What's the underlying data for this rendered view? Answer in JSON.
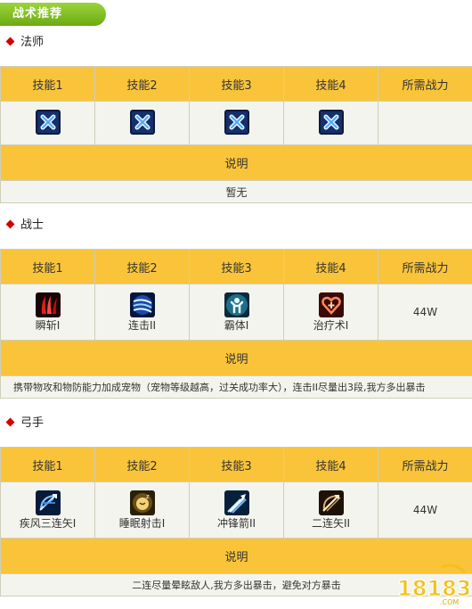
{
  "page": {
    "tab_title": "战术推荐"
  },
  "table_headers": {
    "skill1": "技能1",
    "skill2": "技能2",
    "skill3": "技能3",
    "skill4": "技能4",
    "power": "所需战力",
    "explain": "说明"
  },
  "sections": [
    {
      "title": "法师",
      "skills": [
        {
          "icon": "blank-x-icon",
          "name": ""
        },
        {
          "icon": "blank-x-icon",
          "name": ""
        },
        {
          "icon": "blank-x-icon",
          "name": ""
        },
        {
          "icon": "blank-x-icon",
          "name": ""
        }
      ],
      "power": "",
      "note": "暂无"
    },
    {
      "title": "战士",
      "skills": [
        {
          "icon": "slash-icon",
          "name": "瞬斩I"
        },
        {
          "icon": "combo-strike-icon",
          "name": "连击II"
        },
        {
          "icon": "tyrant-body-icon",
          "name": "霸体I"
        },
        {
          "icon": "heal-heart-icon",
          "name": "治疗术I"
        }
      ],
      "power": "44W",
      "note": "携带物攻和物防能力加成宠物（宠物等级越高，过关成功率大），连击II尽量出3段,我方多出暴击"
    },
    {
      "title": "弓手",
      "skills": [
        {
          "icon": "wind-arrow-icon",
          "name": "疾风三连矢I"
        },
        {
          "icon": "sleep-shot-icon",
          "name": "睡眠射击I"
        },
        {
          "icon": "rush-arrow-icon",
          "name": "冲锋箭II"
        },
        {
          "icon": "double-arrow-icon",
          "name": "二连矢II"
        }
      ],
      "power": "44W",
      "note": "二连尽量晕眩敌人,我方多出暴击，避免对方暴击"
    }
  ],
  "watermark": {
    "text": "18183",
    "sub": ".COM"
  }
}
